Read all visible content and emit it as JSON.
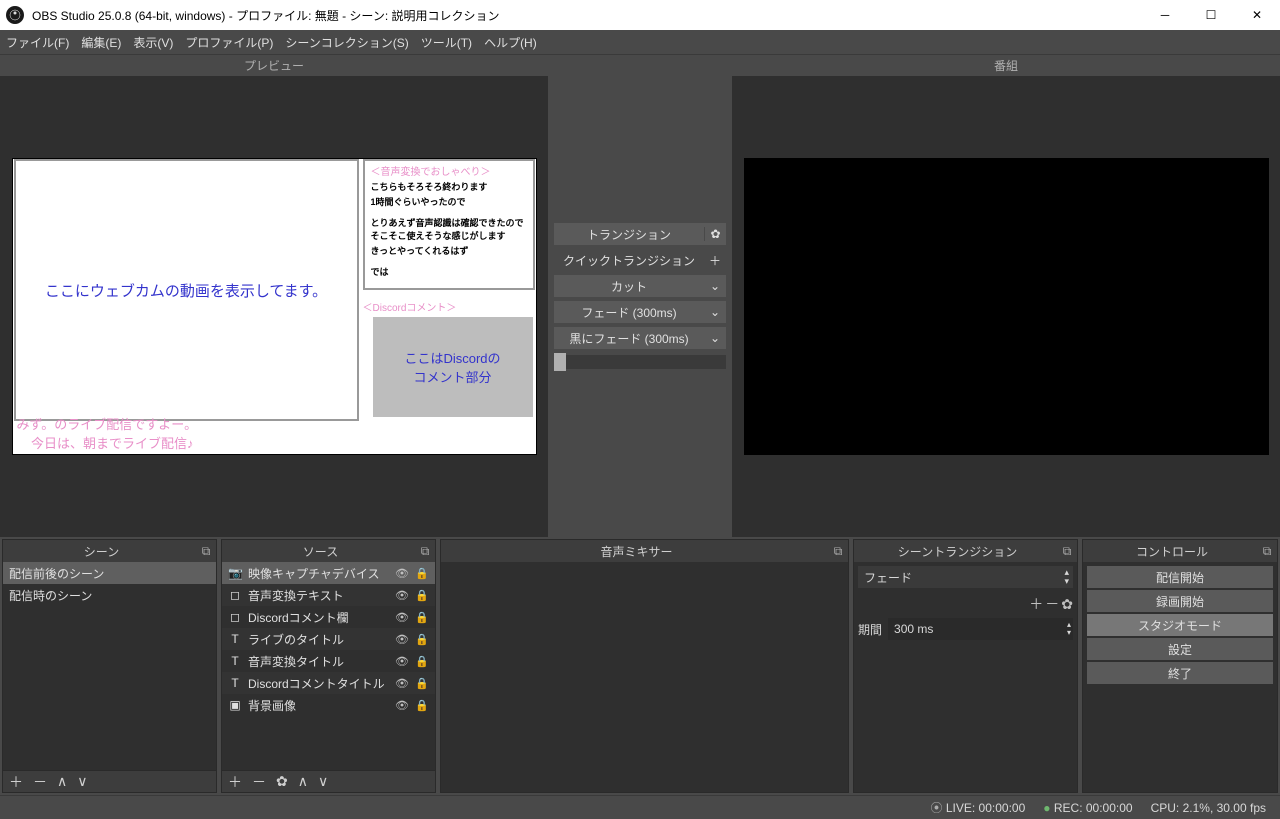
{
  "window": {
    "title": "OBS Studio 25.0.8 (64-bit, windows) - プロファイル: 無題 - シーン: 説明用コレクション"
  },
  "menu": {
    "file": "ファイル(F)",
    "edit": "編集(E)",
    "view": "表示(V)",
    "profile": "プロファイル(P)",
    "scenecol": "シーンコレクション(S)",
    "tools": "ツール(T)",
    "help": "ヘルプ(H)"
  },
  "panes": {
    "preview": "プレビュー",
    "program": "番組"
  },
  "preview_mock": {
    "webcam_text": "ここにウェブカムの動画を表示してます。",
    "voice_hdr": "＜音声変換でおしゃべり＞",
    "voice_l1": "こちらもそろそろ終わります",
    "voice_l2": "1時間ぐらいやったので",
    "voice_l3": "とりあえず音声認識は確認できたのでそこそこ使えそうな感じがします",
    "voice_l4": "きっとやってくれるはず",
    "voice_l5": "では",
    "discord_hdr": "＜Discordコメント＞",
    "discord_text": "ここはDiscordの\nコメント部分",
    "footer1": "みず。のライブ配信ですよー。",
    "footer2": "今日は、朝までライブ配信♪"
  },
  "transitions": {
    "main": "トランジション",
    "quick": "クイックトランジション",
    "cut": "カット",
    "fade": "フェード (300ms)",
    "blackfade": "黒にフェード (300ms)"
  },
  "docks": {
    "scenes": "シーン",
    "sources": "ソース",
    "mixer": "音声ミキサー",
    "scene_trans": "シーントランジション",
    "controls": "コントロール"
  },
  "scenes": [
    "配信前後のシーン",
    "配信時のシーン"
  ],
  "sources": [
    {
      "icon": "camera",
      "name": "映像キャプチャデバイス"
    },
    {
      "icon": "window",
      "name": "音声変換テキスト"
    },
    {
      "icon": "window",
      "name": "Discordコメント欄"
    },
    {
      "icon": "text",
      "name": "ライブのタイトル"
    },
    {
      "icon": "text",
      "name": "音声変換タイトル"
    },
    {
      "icon": "text",
      "name": "Discordコメントタイトル"
    },
    {
      "icon": "image",
      "name": "背景画像"
    }
  ],
  "scene_trans": {
    "mode": "フェード",
    "duration_label": "期間",
    "duration_value": "300 ms"
  },
  "controls": {
    "stream": "配信開始",
    "record": "録画開始",
    "studio": "スタジオモード",
    "settings": "設定",
    "exit": "終了"
  },
  "status": {
    "live": "LIVE: 00:00:00",
    "rec": "REC: 00:00:00",
    "cpu": "CPU: 2.1%, 30.00 fps"
  }
}
